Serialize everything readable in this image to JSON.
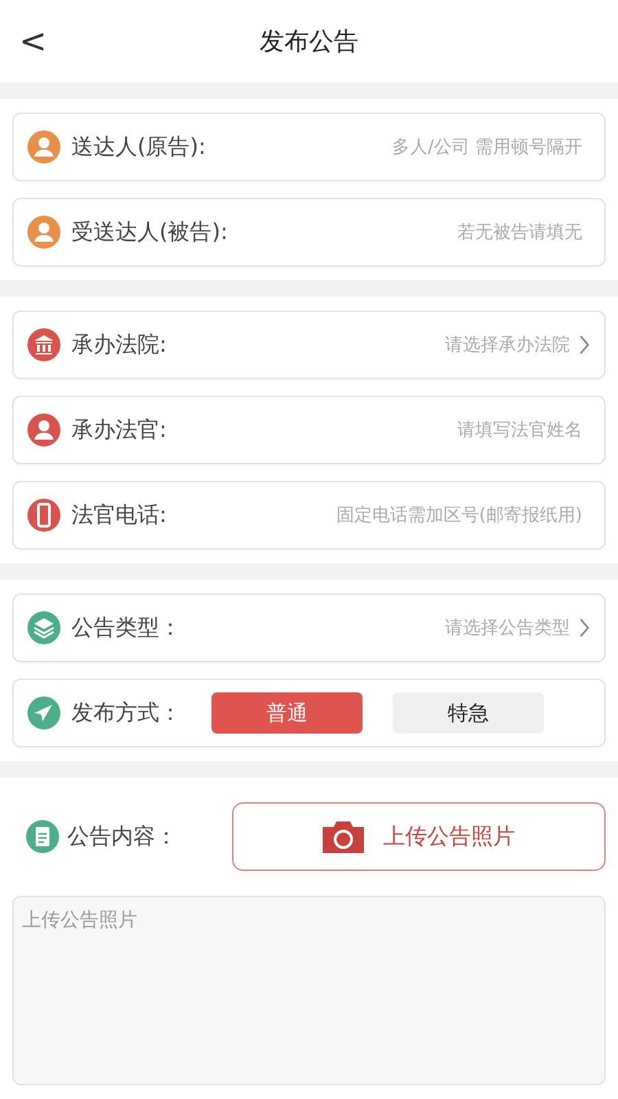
{
  "header": {
    "back": "<",
    "title": "发布公告"
  },
  "sections": [
    {
      "rows": [
        {
          "kind": "input",
          "color": "#e8904a",
          "label": "送达人(原告):",
          "placeholder": "多人/公司 需用顿号隔开"
        },
        {
          "kind": "input",
          "color": "#e8904a",
          "label": "受送达人(被告):",
          "placeholder": "若无被告请填无"
        }
      ]
    },
    {
      "rows": [
        {
          "kind": "select",
          "color": "#d9534f",
          "label": "承办法院:",
          "placeholder": "请选择承办法院"
        },
        {
          "kind": "input",
          "color": "#d9534f",
          "label": "承办法官:",
          "placeholder": "请填写法官姓名"
        },
        {
          "kind": "input",
          "color": "#d9534f",
          "label": "法官电话:",
          "placeholder": "固定电话需加区号(邮寄报纸用)"
        }
      ]
    },
    {
      "rows": [
        {
          "kind": "select",
          "color": "#4caf8a",
          "label": "公告类型：",
          "placeholder": "请选择公告类型"
        },
        {
          "kind": "toggle",
          "color": "#4caf8a",
          "label": "发布方式：",
          "options": [
            {
              "label": "普通",
              "selected": true
            },
            {
              "label": "特急",
              "selected": false
            }
          ]
        }
      ]
    }
  ],
  "content": {
    "color": "#4caf8a",
    "label": "公告内容：",
    "upload": "上传公告照片",
    "placeholder": "上传公告照片"
  }
}
